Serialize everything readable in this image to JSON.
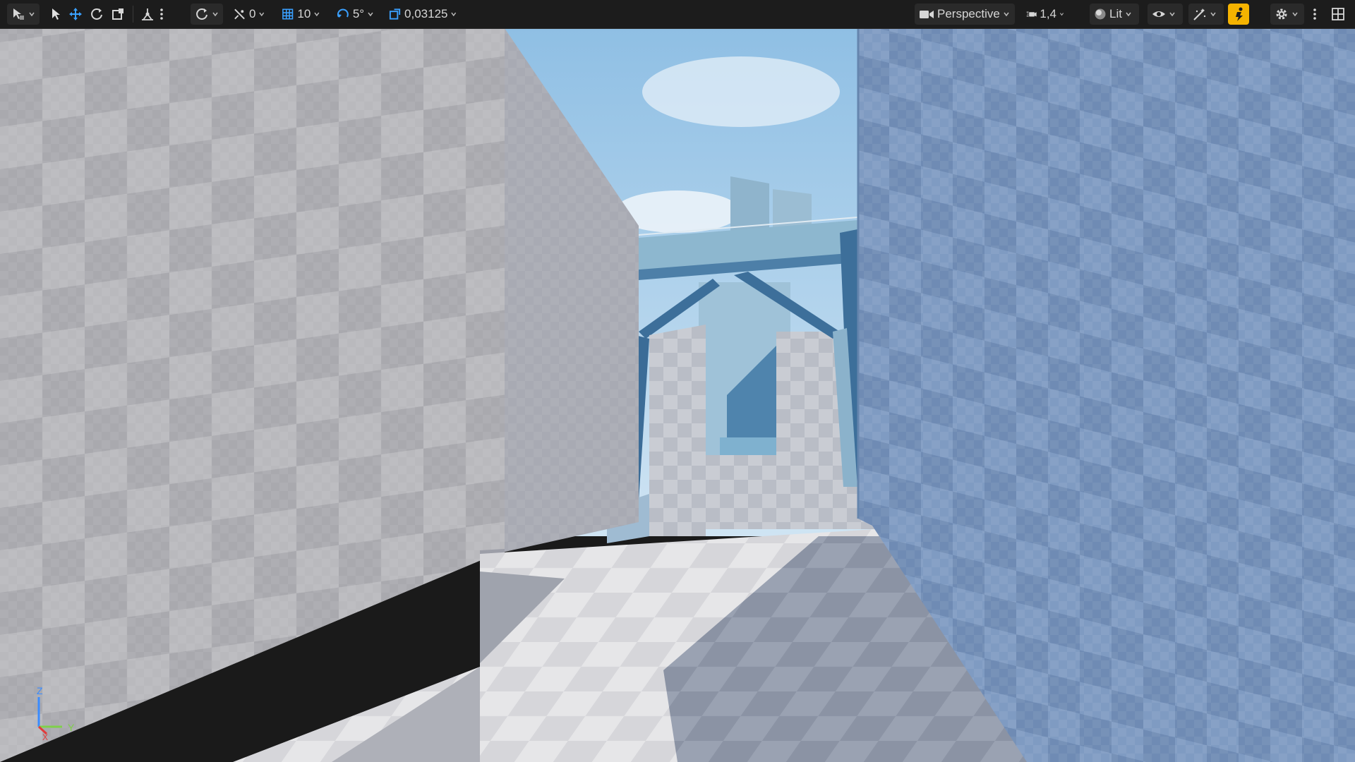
{
  "toolbar": {
    "icons": {
      "select_mode": "select-mode-icon",
      "select": "select-arrow-icon",
      "translate": "translate-icon",
      "rotate": "rotate-icon",
      "scale": "scale-icon",
      "camera_speed_snap": "snap-surface-icon",
      "more": "more-vertical-icon",
      "coordinate_system": "world-icon",
      "surface_snap": "surface-snap-icon",
      "grid_snap": "grid-snap-icon",
      "rotation_snap": "rotation-snap-icon",
      "scale_snap": "scale-snap-icon",
      "camera": "camera-icon",
      "camera_speed": "camera-speed-icon",
      "lit": "lit-sphere-icon",
      "show": "eye-icon",
      "realtime": "realtime-icon",
      "game_view": "lightning-person-icon",
      "settings": "gear-icon",
      "menu": "kebab-icon",
      "layout": "layout-grid-icon"
    },
    "surface_snap_value": "0",
    "grid_snap_value": "10",
    "rotation_snap_value": "5°",
    "scale_snap_value": "0,03125",
    "view_mode_label": "Perspective",
    "camera_speed_value": "1,4",
    "lighting_mode": "Lit"
  },
  "axis_gizmo": {
    "z_label": "Z",
    "y_label": "Y",
    "x_label": "X"
  },
  "colors": {
    "toolbar_bg": "#1c1c1c",
    "active_blue": "#3aa0ff",
    "highlight_yellow": "#f5b300",
    "sky": "#a9cde6",
    "structure_blue": "#6d98ba"
  }
}
